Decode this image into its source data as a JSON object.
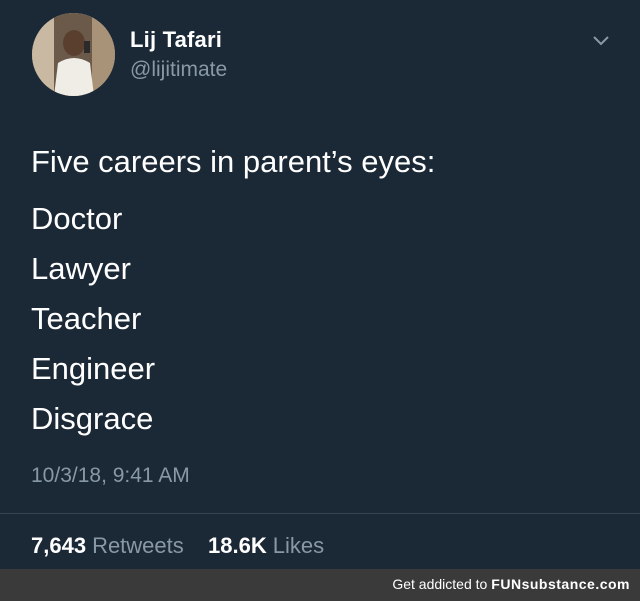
{
  "user": {
    "display_name": "Lij Tafari",
    "handle": "@lijitimate",
    "avatar_icon": "user-avatar-photo"
  },
  "menu_icon": "chevron-down-icon",
  "tweet": {
    "intro": "Five careers in parent’s eyes:",
    "lines": [
      "Doctor",
      "Lawyer",
      "Teacher",
      "Engineer",
      "Disgrace"
    ],
    "timestamp": "10/3/18, 9:41 AM"
  },
  "stats": {
    "retweets_count": "7,643",
    "retweets_label": "Retweets",
    "likes_count": "18.6K",
    "likes_label": "Likes"
  },
  "watermark": {
    "prefix": "Get addicted to",
    "brand": "FUNsubstance.com"
  },
  "colors": {
    "background": "#1b2836",
    "text": "#ffffff",
    "muted": "#8899a6",
    "footer": "#3a3a3a"
  }
}
